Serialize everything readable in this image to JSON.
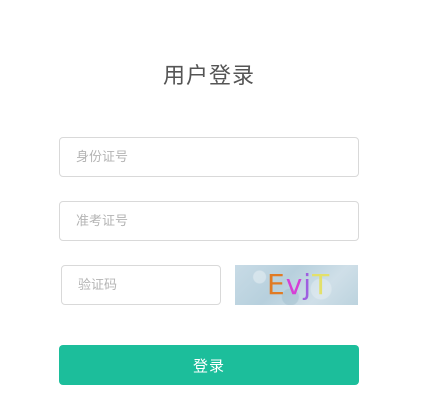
{
  "title": "用户登录",
  "form": {
    "id_number": {
      "placeholder": "身份证号",
      "value": ""
    },
    "exam_number": {
      "placeholder": "准考证号",
      "value": ""
    },
    "verification_code": {
      "placeholder": "验证码",
      "value": ""
    },
    "captcha": {
      "chars": [
        "E",
        "v",
        "j",
        "T"
      ],
      "colors": [
        "#e07b24",
        "#d63fd6",
        "#9e5fe0",
        "#e3e06a"
      ]
    },
    "submit_label": "登录"
  },
  "colors": {
    "accent": "#1cbe9b",
    "title_text": "#555555",
    "border": "#d9d9d9",
    "placeholder": "#b4b4b4"
  }
}
